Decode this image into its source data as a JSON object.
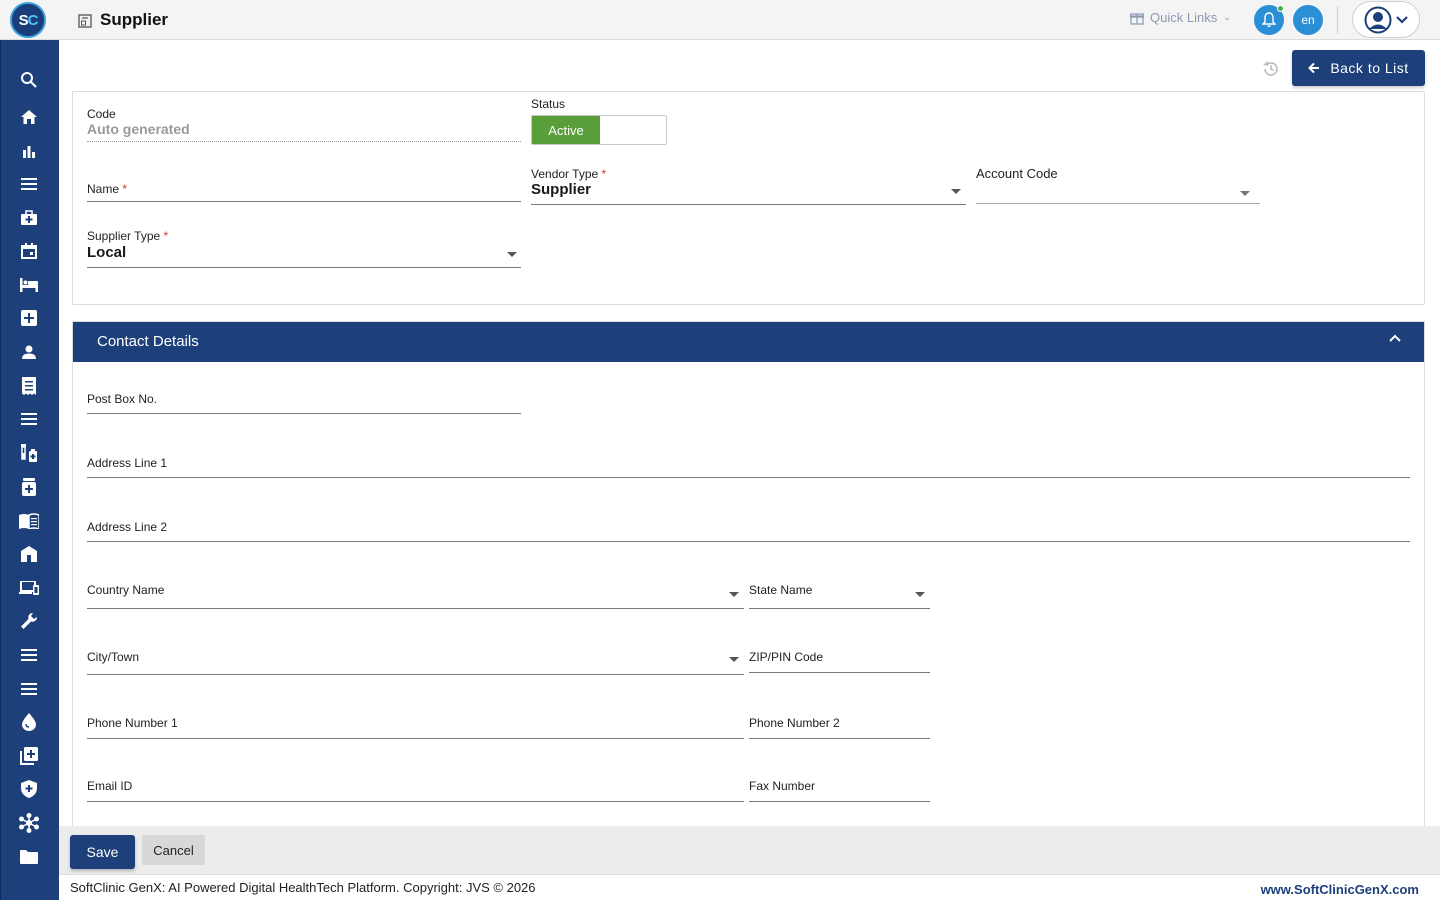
{
  "app": {
    "logo_text_s": "S",
    "logo_text_c": "C",
    "page_title": "Supplier"
  },
  "topbar": {
    "quick_links": "Quick Links",
    "language": "en",
    "colors": {
      "accent": "#2b8fd6",
      "brand": "#1d3f7a",
      "status_dot": "#4caf50"
    }
  },
  "sidebar": {
    "icons": [
      "search-icon",
      "home-icon",
      "bar-chart-icon",
      "menu-icon",
      "medical-bag-icon",
      "calendar-icon",
      "bed-icon",
      "plus-box-icon",
      "person-icon",
      "receipt-icon",
      "list-icon",
      "lab-icon",
      "pharmacy-icon",
      "book-icon",
      "building-icon",
      "devices-icon",
      "wrench-icon",
      "menu-icon",
      "menu-icon",
      "drop-icon",
      "add-box-icon",
      "shield-icon",
      "network-icon",
      "folder-icon"
    ]
  },
  "header_actions": {
    "back_label": "Back to List"
  },
  "form": {
    "code": {
      "label": "Code",
      "placeholder": "Auto generated"
    },
    "status": {
      "label": "Status",
      "value": "Active"
    },
    "name": {
      "label": "Name",
      "required": "*",
      "value": ""
    },
    "vendor_type": {
      "label": "Vendor Type",
      "required": "*",
      "value": "Supplier"
    },
    "account_code": {
      "label": "Account Code",
      "value": ""
    },
    "supplier_type": {
      "label": "Supplier Type",
      "required": "*",
      "value": "Local"
    }
  },
  "contact": {
    "title": "Contact Details",
    "post_box": {
      "label": "Post Box No."
    },
    "address1": {
      "label": "Address Line 1"
    },
    "address2": {
      "label": "Address Line 2"
    },
    "country": {
      "label": "Country Name"
    },
    "state": {
      "label": "State Name"
    },
    "city": {
      "label": "City/Town"
    },
    "zip": {
      "label": "ZIP/PIN Code"
    },
    "phone1": {
      "label": "Phone Number 1"
    },
    "phone2": {
      "label": "Phone Number 2"
    },
    "email": {
      "label": "Email ID"
    },
    "fax": {
      "label": "Fax Number"
    }
  },
  "actions": {
    "save": "Save",
    "cancel": "Cancel"
  },
  "footer": {
    "copyright": "SoftClinic GenX: AI Powered Digital HealthTech Platform. Copyright: JVS © 2026",
    "site": "www.SoftClinicGenX.com"
  }
}
